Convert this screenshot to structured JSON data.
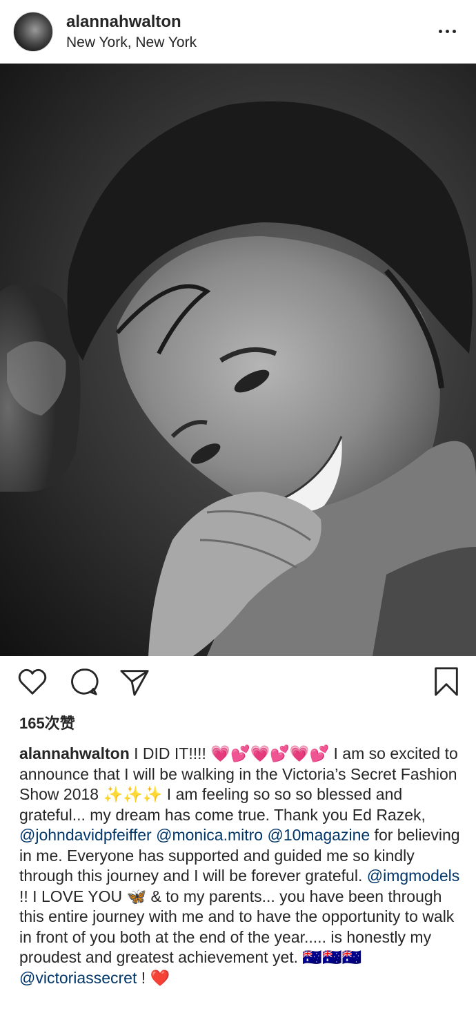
{
  "post": {
    "username": "alannahwalton",
    "location": "New York, New York"
  },
  "icons": {
    "more": "more-horizontal-icon",
    "like": "heart-outline-icon",
    "comment": "comment-bubble-icon",
    "share": "paper-plane-icon",
    "save": "bookmark-icon"
  },
  "likes": "165次赞",
  "caption": {
    "username": "alannahwalton",
    "seg1": " I DID IT!!!! 💗💕💗💕💗💕 I am so excited to announce that I will be walking in the Victoria’s Secret Fashion Show 2018 ✨✨✨ I am feeling so so so blessed and grateful... my dream has come true. Thank you Ed Razek, ",
    "mention1": "@johndavidpfeiffer",
    "seg2": " ",
    "mention2": "@monica.mitro",
    "seg3": " ",
    "mention3": "@10magazine",
    "seg4": " for believing in me. Everyone has supported and guided me so kindly through this journey and I will be forever grateful. ",
    "mention4": "@imgmodels",
    "seg5": " !! I LOVE YOU 🦋 & to my parents... you have been through this entire journey with me and to have the opportunity to walk in front of you both at the end of the year..... is honestly my proudest and greatest achievement yet. 🇦🇺🇦🇺🇦🇺 ",
    "mention5": "@victoriassecret",
    "seg6": " ! ❤️"
  },
  "colors": {
    "text": "#262626",
    "mention": "#003569",
    "photo": "#3d3d3d"
  }
}
